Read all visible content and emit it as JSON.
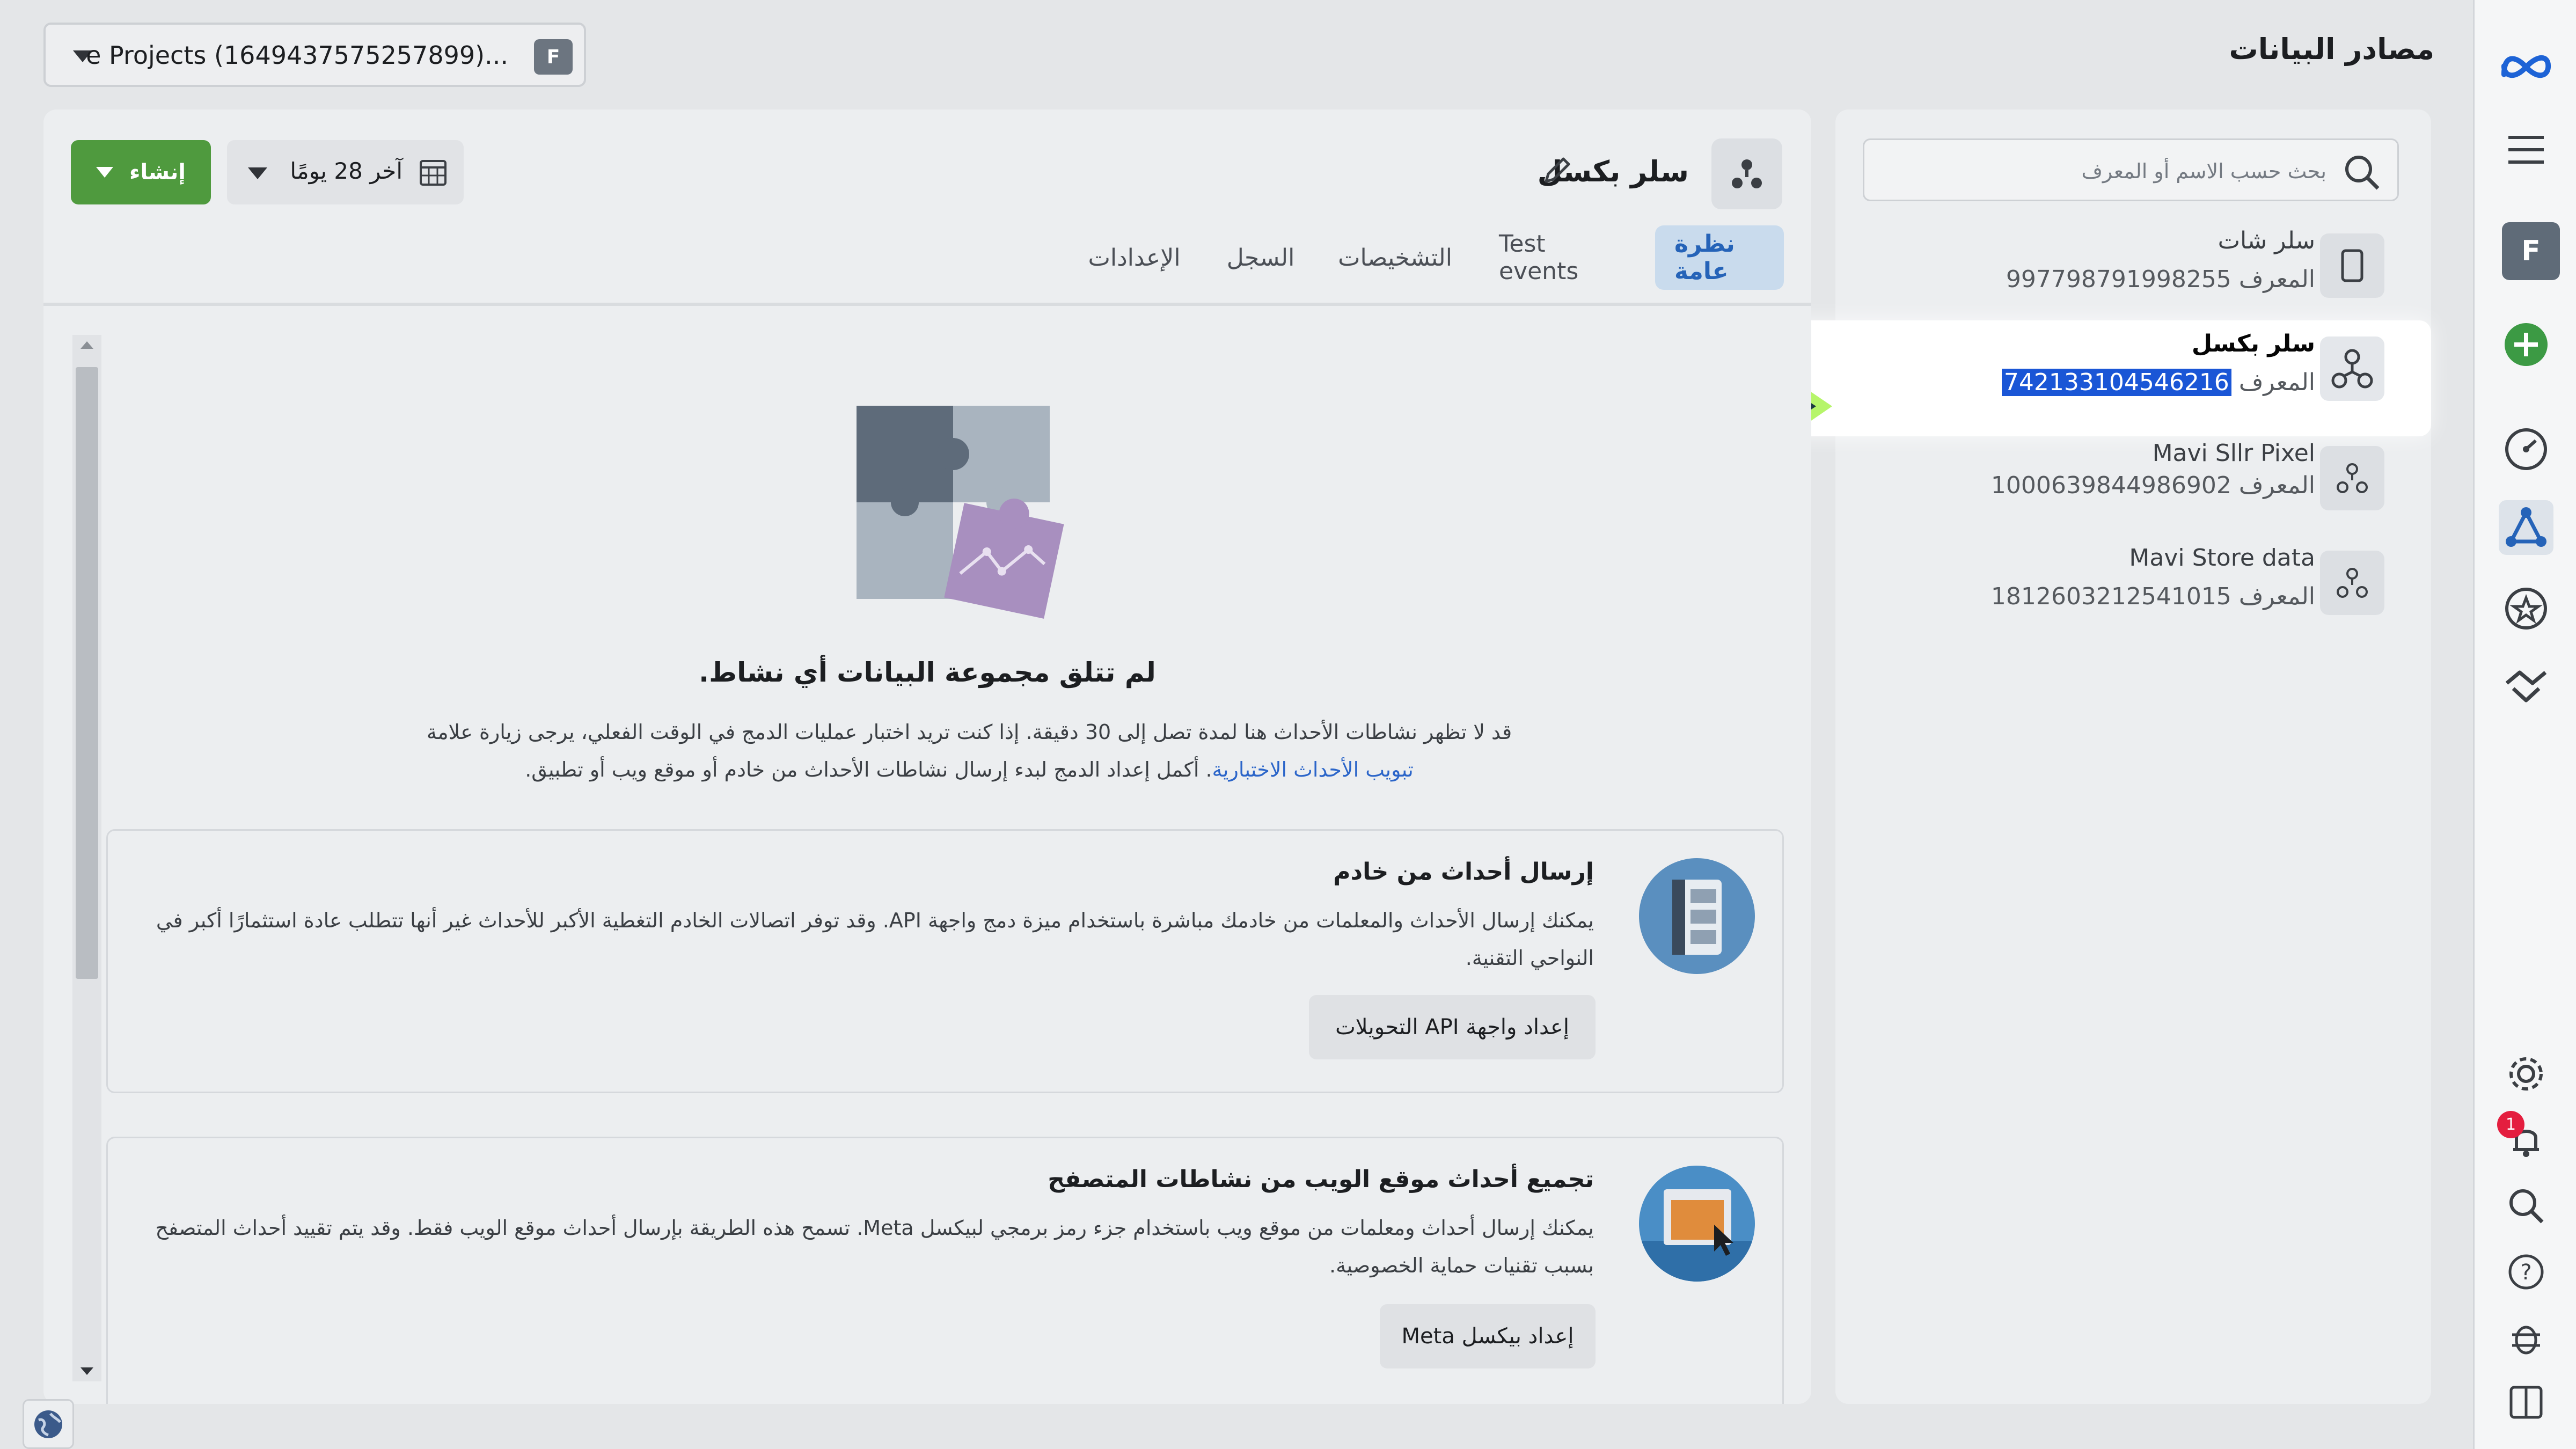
{
  "page": {
    "title": "مصادر البيانات"
  },
  "account_selector": {
    "label": "e Projects (1649437575257899)...",
    "badge": "F"
  },
  "sidebar_rail": {
    "avatar": "F",
    "notification_count": "1"
  },
  "search": {
    "placeholder": "بحث حسب الاسم أو المعرف"
  },
  "datasources": [
    {
      "name": "سلر شات",
      "id_label": "المعرف",
      "id": "997798791998255",
      "icon": "phone-icon"
    },
    {
      "name": "سلر بكسل",
      "id_label": "المعرف",
      "id": "742133104546216",
      "icon": "pixel-icon",
      "selected": true
    },
    {
      "name": "Mavi Sllr Pixel",
      "id_label": "المعرف",
      "id": "1000639844986902",
      "icon": "pixel-icon"
    },
    {
      "name": "Mavi Store data",
      "id_label": "المعرف",
      "id": "1812603212541015",
      "icon": "pixel-icon"
    }
  ],
  "main": {
    "name": "سلر بكسل",
    "create_label": "إنشاء",
    "date_range": "آخر 28 يومًا",
    "tabs": [
      "نظرة عامة",
      "Test events",
      "التشخيصات",
      "السجل",
      "الإعدادات"
    ],
    "active_tab": 0,
    "empty": {
      "title": "لم تتلق مجموعة البيانات أي نشاط.",
      "desc_1": "قد لا تظهر نشاطات الأحداث هنا لمدة تصل إلى 30 دقيقة. إذا كنت تريد اختبار عمليات الدمج في الوقت الفعلي، يرجى زيارة علامة",
      "desc_link": "تبويب الأحداث الاختبارية",
      "desc_2": ". أكمل إعداد الدمج لبدء إرسال نشاطات الأحداث من خادم أو موقع ويب أو تطبيق."
    },
    "cards": [
      {
        "title": "إرسال أحداث من خادم",
        "desc": "يمكنك إرسال الأحداث والمعلمات من خادمك مباشرة باستخدام ميزة دمج واجهة API. وقد توفر اتصالات الخادم التغطية الأكبر للأحداث غير أنها تتطلب عادة استثمارًا أكبر في النواحي التقنية.",
        "button": "إعداد واجهة API التحويلات"
      },
      {
        "title": "تجميع أحداث موقع الويب من نشاطات المتصفح",
        "desc": "يمكنك إرسال أحداث ومعلمات من موقع ويب باستخدام جزء رمز برمجي لبيكسل Meta. تسمح هذه الطريقة بإرسال أحداث موقع الويب فقط. وقد يتم تقييد أحداث المتصفح بسبب تقنيات حماية الخصوصية.",
        "button": "إعداد بيكسل Meta"
      }
    ]
  },
  "colors": {
    "accent": "#2563b8",
    "create": "#4f9a3e",
    "arrow": "#1b3a40",
    "arrow_glow": "#b6f56a",
    "selection": "#1a56d6"
  }
}
